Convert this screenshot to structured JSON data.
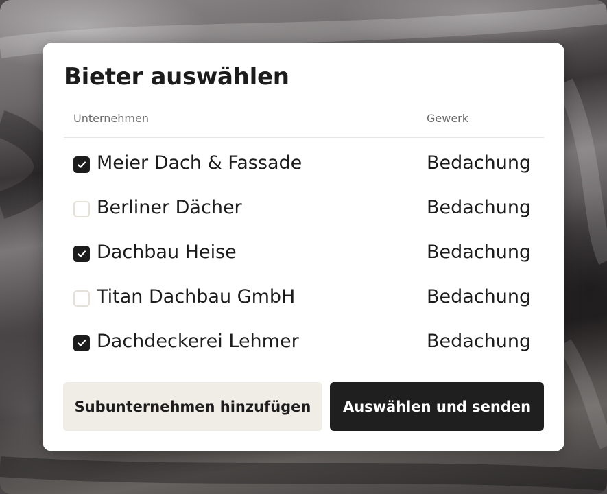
{
  "dialog": {
    "title": "Bieter auswählen",
    "columns": {
      "company": "Unternehmen",
      "trade": "Gewerk"
    },
    "rows": [
      {
        "name": "Meier Dach & Fassade",
        "trade": "Bedachung",
        "checked": true
      },
      {
        "name": "Berliner Dächer",
        "trade": "Bedachung",
        "checked": false
      },
      {
        "name": "Dachbau Heise",
        "trade": "Bedachung",
        "checked": true
      },
      {
        "name": "Titan Dachbau GmbH",
        "trade": "Bedachung",
        "checked": false
      },
      {
        "name": "Dachdeckerei Lehmer",
        "trade": "Bedachung",
        "checked": true
      }
    ],
    "buttons": {
      "add_subcontractor": "Subunternehmen hinzufügen",
      "select_and_send": "Auswählen und senden"
    }
  },
  "colors": {
    "accent": "#1f1f1f",
    "secondary_button": "#f0ece6",
    "checkbox_unchecked_border": "#e6e0d5"
  },
  "icons": {
    "checkbox_checked": "check-icon"
  }
}
